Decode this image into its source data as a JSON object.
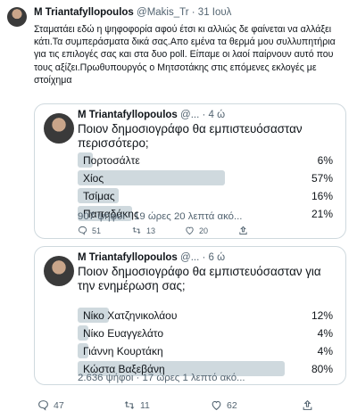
{
  "tweet": {
    "author_name": "M Triantafyllopoulos",
    "handle": "@Makis_Tr",
    "separator": "·",
    "date": "31 Ιουλ",
    "text": "Σταματάει εδώ η ψηφοφορία  αφού έτσι κι αλλιώς δε φαίνεται να αλλάξει κάτι.Τα συμπεράσματα δικά σας.Απο εμένα τα θερμά μου συλλυπητήρια για τις επιλογές σας και στα δυο poll. Είπαμε οι λαοί παίρνουν αυτό που τους αξίζει.Πρωθυπουργός ο Μητσοτάκης στις επόμενες εκλογές με στοίχημα",
    "actions": {
      "replies": "47",
      "retweets": "11",
      "likes": "62"
    },
    "icons": {
      "reply": "comment-icon",
      "retweet": "retweet-icon",
      "like": "heart-icon",
      "share": "share-icon"
    }
  },
  "quotes": [
    {
      "author_name": "M Triantafyllopoulos",
      "handle": "@...",
      "separator": "·",
      "date": "4 ώ",
      "question": "Ποιον δημοσιογράφο θα εμπιστευόσασταν  περισσότερο;",
      "options": [
        {
          "label": "Πορτοσάλτε",
          "pct": "6%",
          "value": 6
        },
        {
          "label": "Χίος",
          "pct": "57%",
          "value": 57
        },
        {
          "label": "Τσίμας",
          "pct": "16%",
          "value": 16
        },
        {
          "label": "Παπαδάκης",
          "pct": "21%",
          "value": 21
        }
      ],
      "meta": "907 ψήφοι · 19 ώρες 20 λεπτά ακό...",
      "actions": {
        "replies": "51",
        "retweets": "13",
        "likes": "20"
      }
    },
    {
      "author_name": "M Triantafyllopoulos",
      "handle": "@...",
      "separator": "·",
      "date": "6 ώ",
      "question": "Ποιον δημοσιογράφο θα εμπιστευόσασταν για την ενημέρωση σας;",
      "options": [
        {
          "label": "Νίκο Χατζηνικολάου",
          "pct": "12%",
          "value": 12
        },
        {
          "label": "Νίκο Ευαγγελάτο",
          "pct": "4%",
          "value": 4
        },
        {
          "label": "Γιάννη Κουρτάκη",
          "pct": "4%",
          "value": 4
        },
        {
          "label": "Κώστα Βαξεβάνη",
          "pct": "80%",
          "value": 80
        }
      ],
      "meta": "2.636 ψήφοι · 17 ώρες 1 λεπτό ακό..."
    }
  ],
  "colors": {
    "bar": "#cfd9de",
    "muted": "#536471",
    "text": "#0f1419",
    "border": "#cfd9de"
  }
}
